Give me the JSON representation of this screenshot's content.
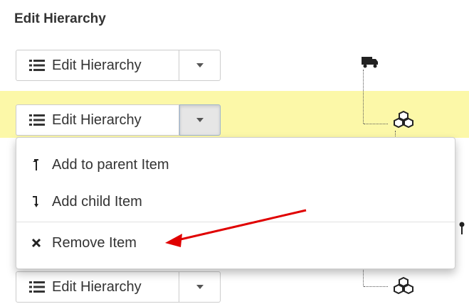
{
  "heading": "Edit Hierarchy",
  "rows": [
    {
      "label": "Edit Hierarchy"
    },
    {
      "label": "Edit Hierarchy"
    },
    {
      "label": "Edit Hierarchy"
    }
  ],
  "dropdown": {
    "items": [
      {
        "label": "Add to parent Item",
        "icon": "arrow-up-icon"
      },
      {
        "label": "Add child Item",
        "icon": "arrow-down-icon"
      },
      {
        "label": "Remove Item",
        "icon": "close-icon"
      }
    ]
  },
  "colors": {
    "highlight": "#fcf8a8",
    "annotation_arrow": "#e00000"
  }
}
